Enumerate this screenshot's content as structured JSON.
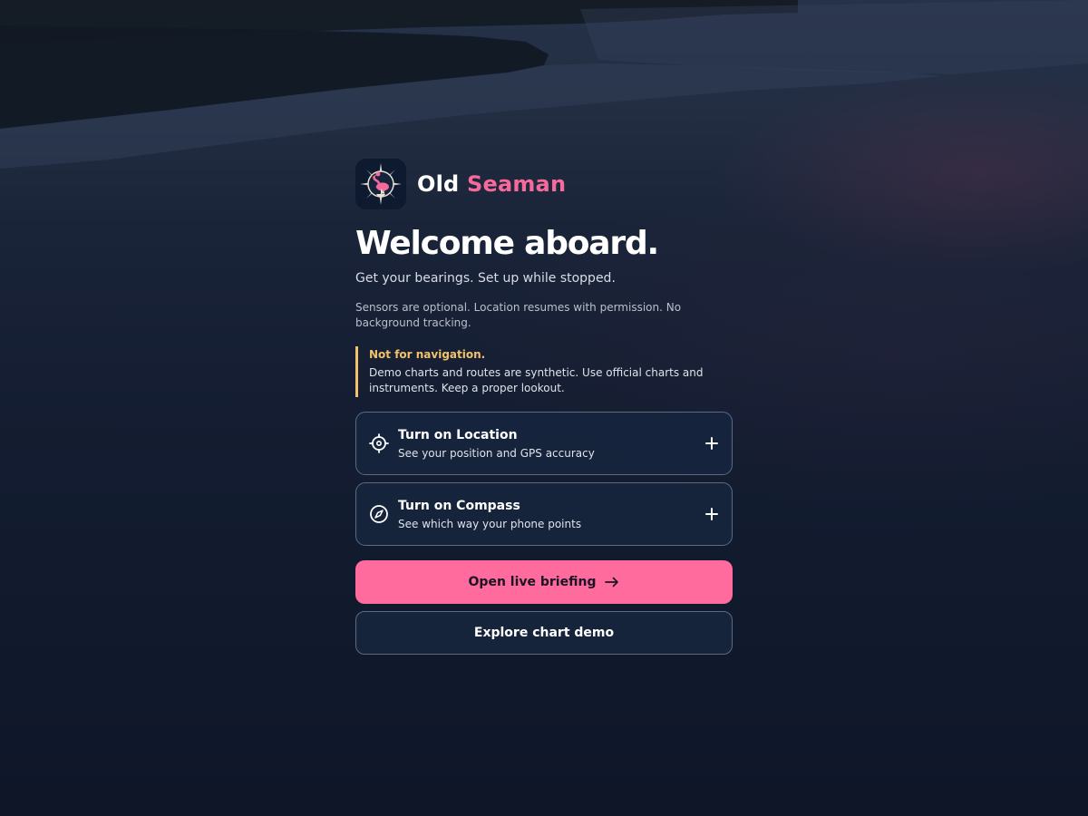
{
  "brand": {
    "name_part1": "Old",
    "name_part2": "Seaman",
    "accent_color": "#f56a9a",
    "logo_icon": "compass-flamingo-logo-icon"
  },
  "hero": {
    "title": "Welcome aboard.",
    "subtitle": "Get your bearings. Set up while stopped."
  },
  "privacy_note": "Sensors are optional. Location resumes with permission. No background tracking.",
  "warning": {
    "title": "Not for navigation.",
    "body": "Demo charts and routes are synthetic. Use official charts and instruments. Keep a proper lookout.",
    "color": "#f2c26b"
  },
  "permissions": [
    {
      "icon": "crosshair-icon",
      "title": "Turn on Location",
      "description": "See your position and GPS accuracy",
      "action_icon": "plus-icon"
    },
    {
      "icon": "compass-icon",
      "title": "Turn on Compass",
      "description": "See which way your phone points",
      "action_icon": "plus-icon"
    }
  ],
  "actions": {
    "primary_label": "Open live briefing",
    "primary_icon": "arrow-right-icon",
    "primary_color": "#ff6b9c",
    "secondary_label": "Explore chart demo"
  }
}
